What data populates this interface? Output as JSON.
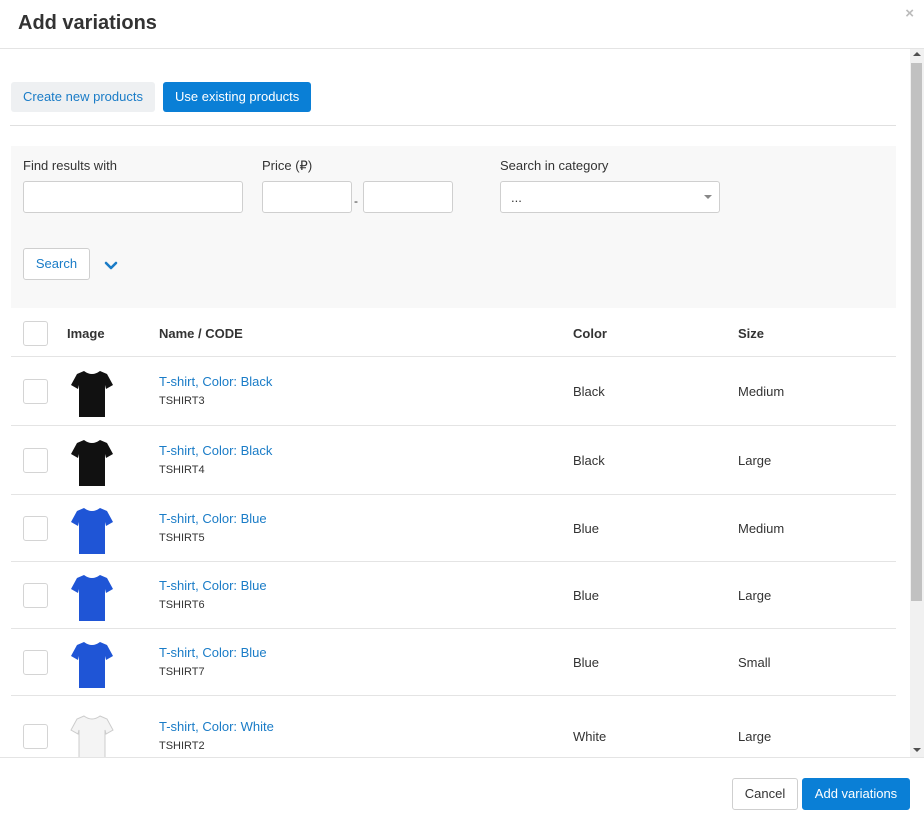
{
  "dialog": {
    "title": "Add variations",
    "close_glyph": "×"
  },
  "tabs": [
    {
      "label": "Create new products",
      "active": false
    },
    {
      "label": "Use existing products",
      "active": true
    }
  ],
  "search": {
    "find_label": "Find results with",
    "find_value": "",
    "price_label": "Price (₽)",
    "price_from": "",
    "price_to": "",
    "price_separator": "-",
    "category_label": "Search in category",
    "category_value": "...",
    "search_button": "Search",
    "expand_icon": "chevron-down-icon"
  },
  "table": {
    "columns": [
      "Image",
      "Name / CODE",
      "Color",
      "Size"
    ],
    "rows": [
      {
        "name": "T-shirt, Color: Black",
        "code": "TSHIRT3",
        "color": "Black",
        "size": "Medium",
        "shirt_color": "#111111"
      },
      {
        "name": "T-shirt, Color: Black",
        "code": "TSHIRT4",
        "color": "Black",
        "size": "Large",
        "shirt_color": "#111111"
      },
      {
        "name": "T-shirt, Color: Blue",
        "code": "TSHIRT5",
        "color": "Blue",
        "size": "Medium",
        "shirt_color": "#1f55d6"
      },
      {
        "name": "T-shirt, Color: Blue",
        "code": "TSHIRT6",
        "color": "Blue",
        "size": "Large",
        "shirt_color": "#1f55d6"
      },
      {
        "name": "T-shirt, Color: Blue",
        "code": "TSHIRT7",
        "color": "Blue",
        "size": "Small",
        "shirt_color": "#1f55d6"
      },
      {
        "name": "T-shirt, Color: White",
        "code": "TSHIRT2",
        "color": "White",
        "size": "Large",
        "shirt_color": "#f4f4f4"
      }
    ]
  },
  "footer": {
    "cancel": "Cancel",
    "add": "Add variations"
  },
  "colors": {
    "accent": "#0a7fd6",
    "link": "#1a7cc7"
  }
}
